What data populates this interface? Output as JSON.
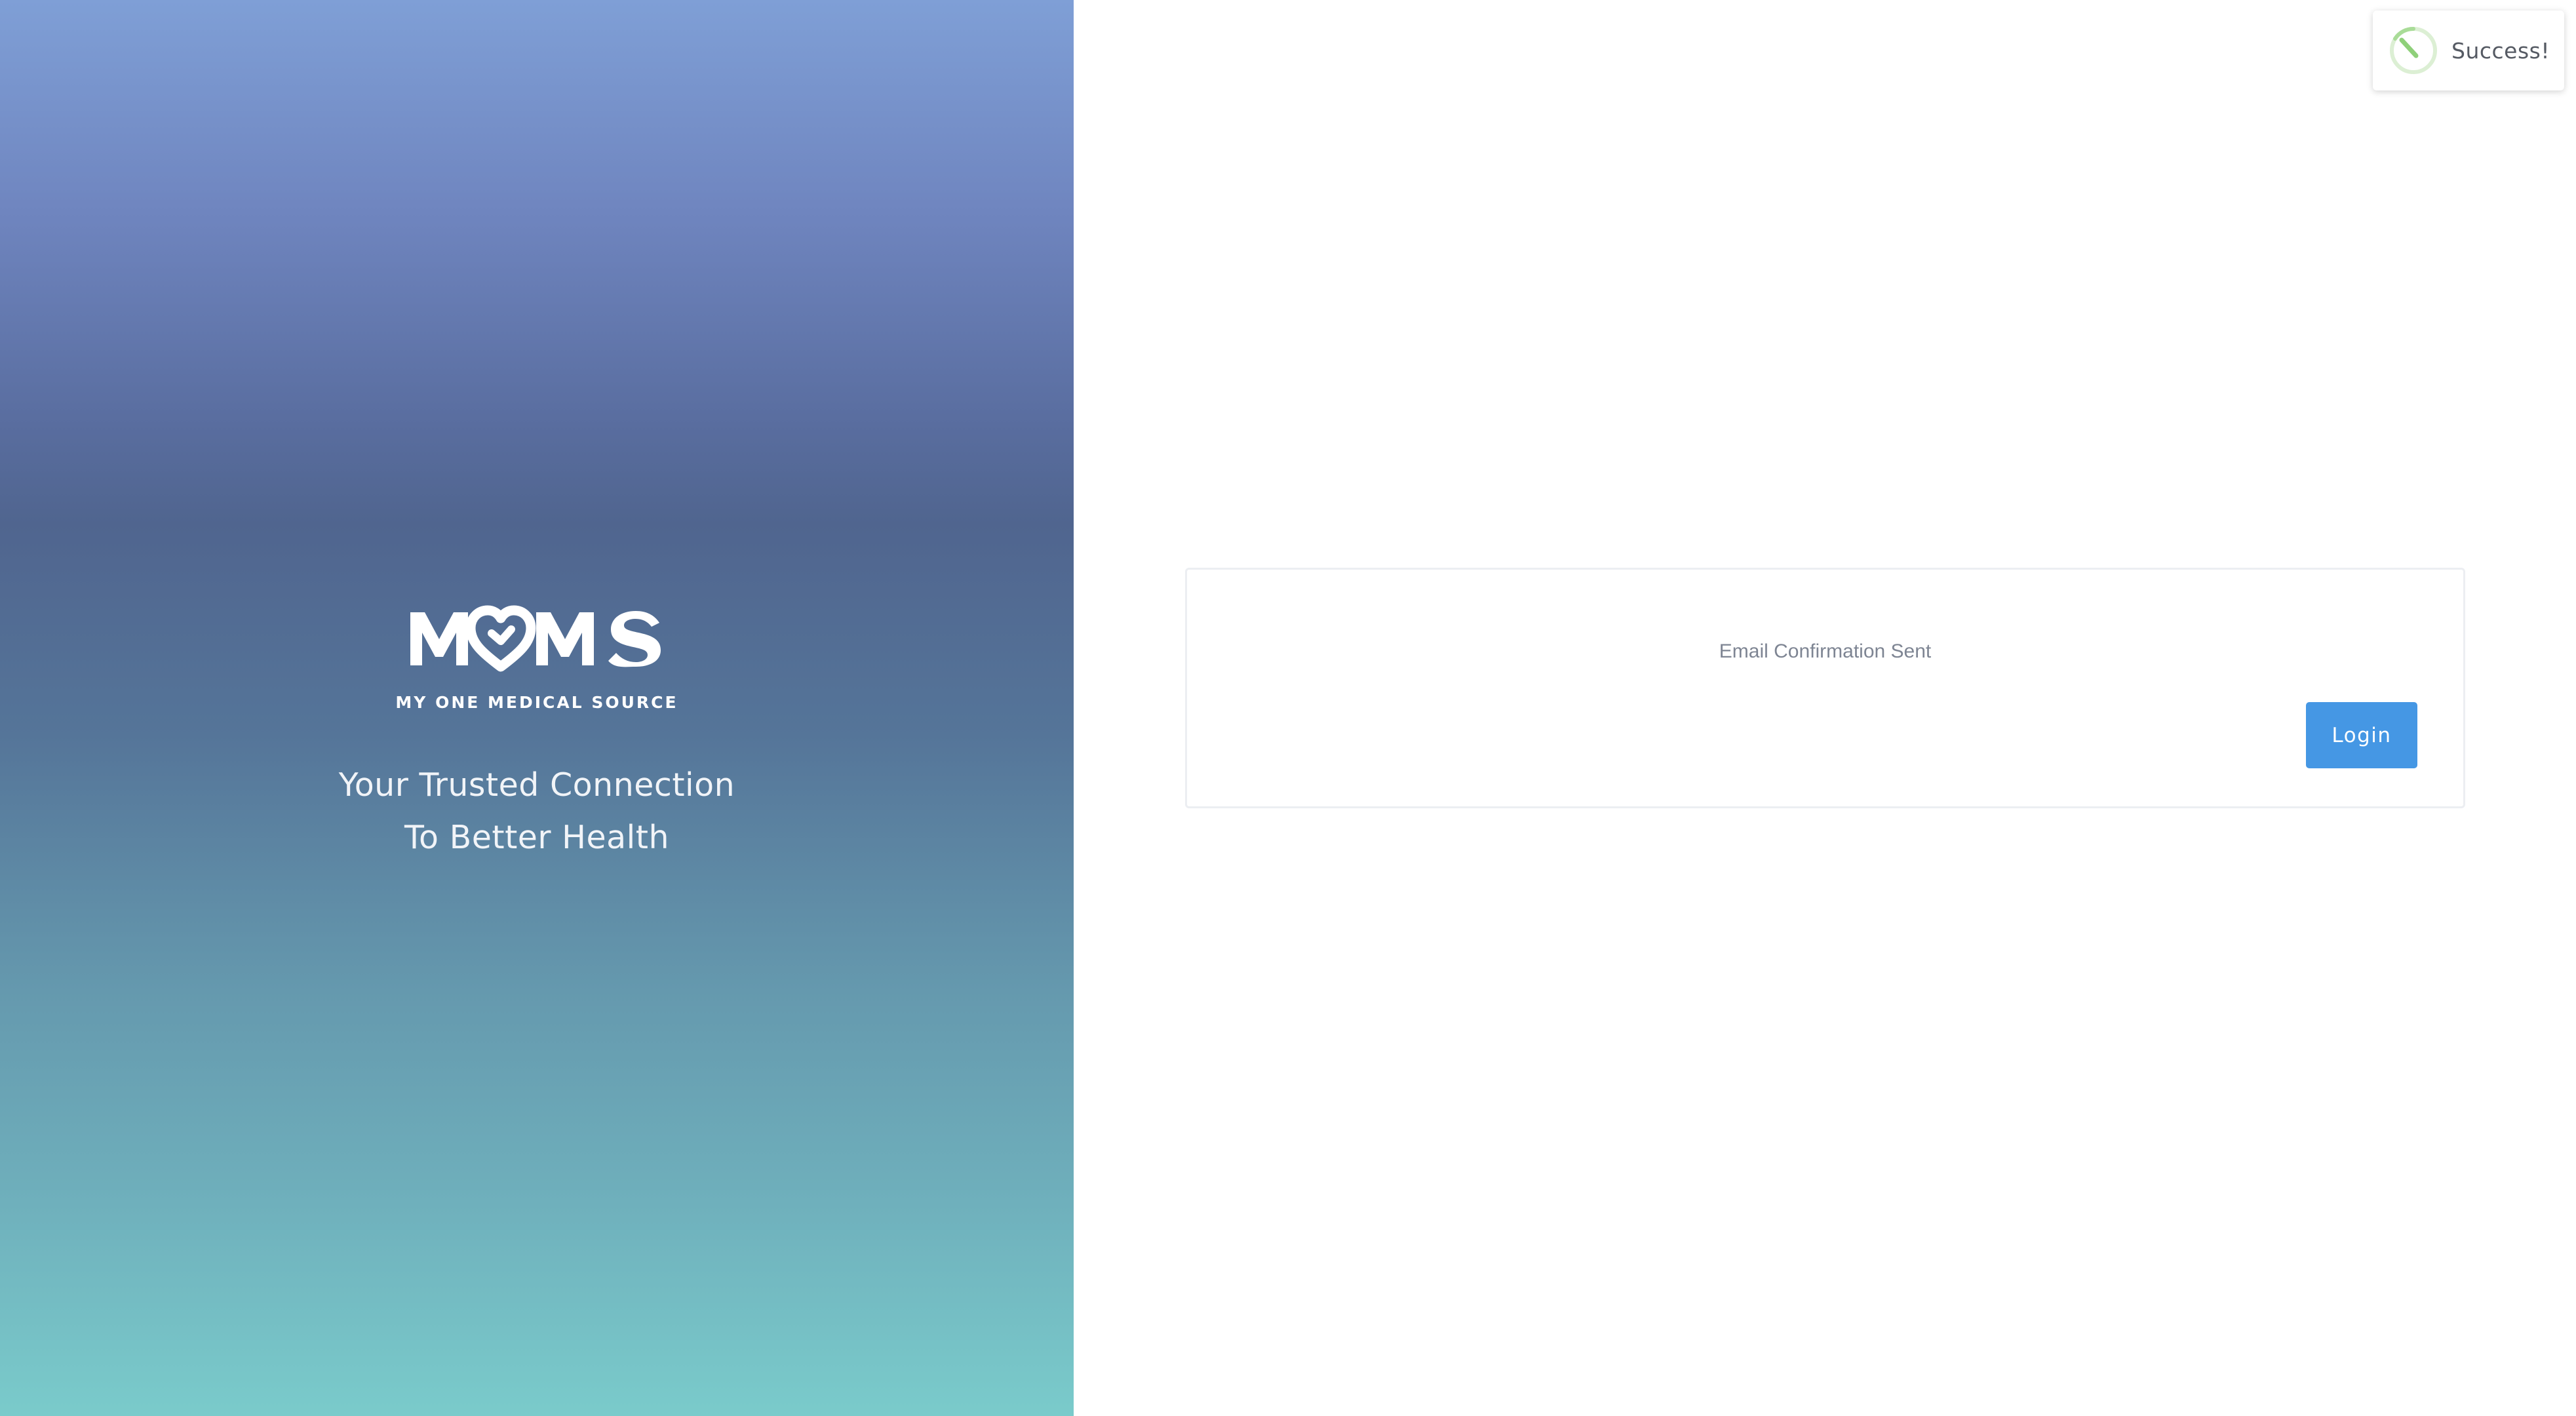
{
  "brand": {
    "logo_wordmark": "MOMS",
    "logo_subtitle": "MY ONE MEDICAL SOURCE",
    "tagline_line1": "Your Trusted Connection",
    "tagline_line2": "To Better Health",
    "logo_icon": "heart-icon"
  },
  "card": {
    "message": "Email Confirmation Sent",
    "login_label": "Login"
  },
  "toast": {
    "message": "Success!",
    "icon": "success-check-icon"
  },
  "colors": {
    "accent": "#4597e4",
    "gradient_top": "#7f9fd6",
    "gradient_mid": "#50658f",
    "gradient_bottom": "#7acbcb",
    "success": "#9bd68a"
  }
}
